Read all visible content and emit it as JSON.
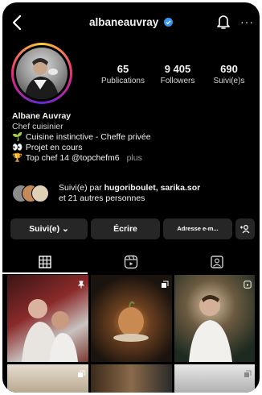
{
  "header": {
    "username": "albaneauvray",
    "verified": true,
    "icons": [
      "back-arrow-icon",
      "verified-badge-icon",
      "bell-icon",
      "more-options-icon"
    ]
  },
  "stats": [
    {
      "value": "65",
      "label": "Publications"
    },
    {
      "value": "9 405",
      "label": "Followers"
    },
    {
      "value": "690",
      "label": "Suivi(e)s"
    }
  ],
  "bio": {
    "name": "Albane Auvray",
    "category": "Chef cuisinier",
    "lines": [
      {
        "emoji": "🌱",
        "text": "Cuisine instinctive - Cheffe privée"
      },
      {
        "emoji": "👀",
        "text": "Projet en cours"
      },
      {
        "emoji": "🏆",
        "text": "Top chef 14 @topchefm6"
      }
    ],
    "more": "plus"
  },
  "followed_by": {
    "prefix": "Suivi(e) par",
    "names": "hugoriboulet, sarika.sor",
    "suffix": "et 21 autres personnes"
  },
  "actions": {
    "follow": "Suivi(e) ⌄",
    "write": "Écrire",
    "email": "Adresse e-m...",
    "add_user": "+⍜"
  },
  "tabs": [
    {
      "name": "grid-tab",
      "icon": "grid-icon",
      "active": true
    },
    {
      "name": "reels-tab",
      "icon": "reels-icon",
      "active": false
    },
    {
      "name": "tagged-tab",
      "icon": "tagged-icon",
      "active": false
    }
  ],
  "colors": {
    "background": "#000000",
    "button": "#262626",
    "verified": "#3897f0"
  }
}
